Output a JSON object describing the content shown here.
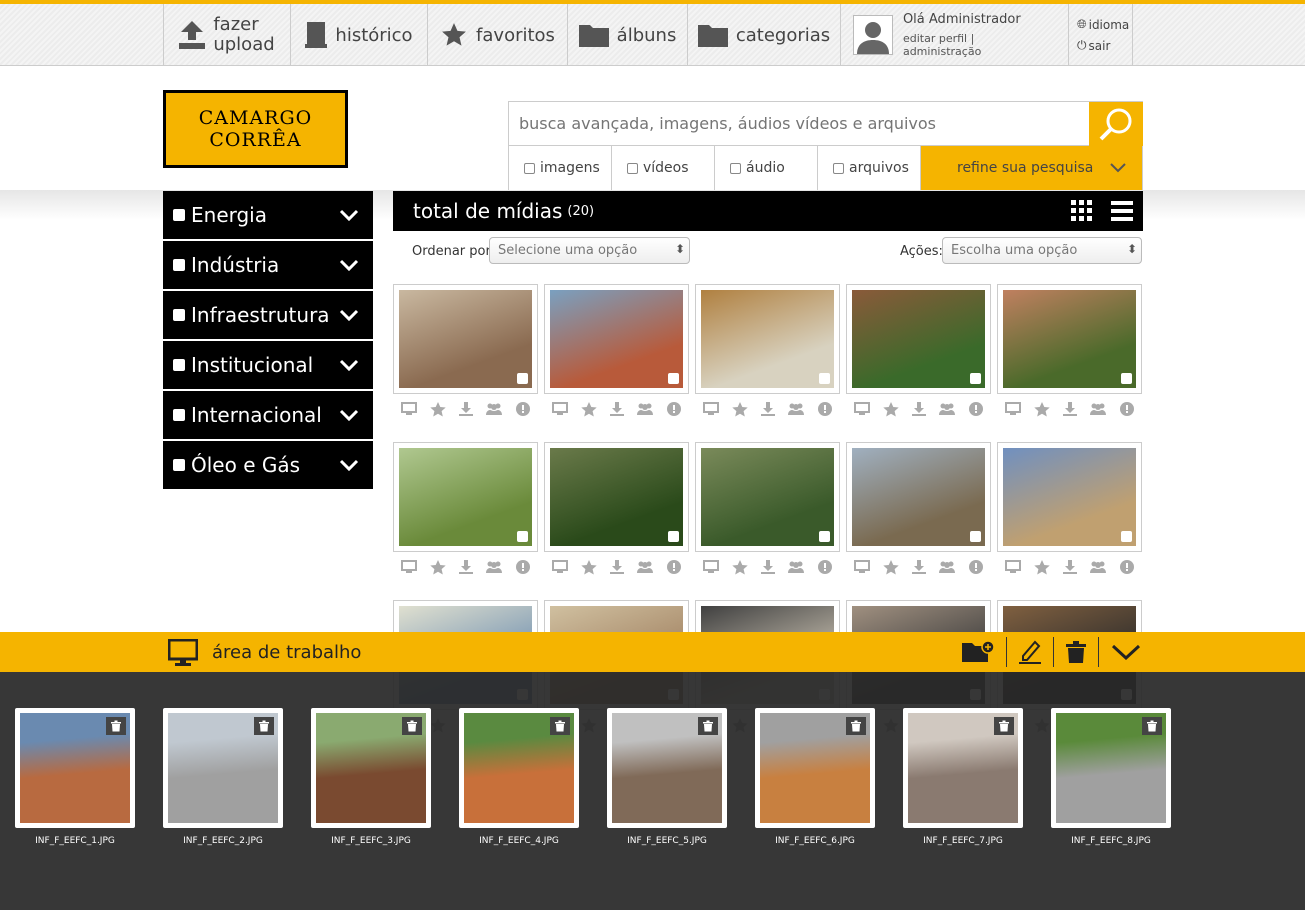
{
  "nav": {
    "upload_line1": "fazer",
    "upload_line2": "upload",
    "history": "histórico",
    "favorites": "favoritos",
    "albums": "álbuns",
    "categories": "categorias",
    "user_greeting": "Olá Administrador",
    "edit_profile": "editar perfil",
    "separator": "|",
    "admin": "administração",
    "language": "idioma",
    "logout": "sair"
  },
  "logo": {
    "line1": "CAMARGO",
    "line2": "CORRÊA"
  },
  "search": {
    "placeholder": "busca avançada, imagens, áudios vídeos e arquivos",
    "filters": [
      "imagens",
      "vídeos",
      "áudio",
      "arquivos"
    ],
    "refine": "refine sua pesquisa"
  },
  "categories": [
    "Energia",
    "Indústria",
    "Infraestrutura",
    "Institucional",
    "Internacional",
    "Óleo e Gás"
  ],
  "media": {
    "title": "total de mídias",
    "count": "(20)",
    "sort_label": "Ordenar por:",
    "sort_value": "Selecione uma opção",
    "actions_label": "Ações:",
    "actions_value": "Escolha uma opção"
  },
  "thumb_colors": [
    [
      "#8a6a50",
      "#c9b8a0"
    ],
    [
      "#b85a3a",
      "#7aa0c0"
    ],
    [
      "#d8d2c0",
      "#b08040"
    ],
    [
      "#3a6a2a",
      "#8a5a3a"
    ],
    [
      "#4a6a2a",
      "#c08060"
    ],
    [
      "#6a8a3a",
      "#b0c890"
    ],
    [
      "#2a4a1a",
      "#6a7a4a"
    ],
    [
      "#3a5a2a",
      "#7a8a5a"
    ],
    [
      "#7a6a50",
      "#a0b0c0"
    ],
    [
      "#c0a070",
      "#7090c0"
    ],
    [
      "#7090b0",
      "#e0e0d0"
    ],
    [
      "#a08060",
      "#d0c0a0"
    ],
    [
      "#c8c0b0",
      "#404040"
    ],
    [
      "#3a3a3a",
      "#a09080"
    ],
    [
      "#2a2a2a",
      "#806040"
    ]
  ],
  "workspace": {
    "title": "área de trabalho",
    "files": [
      {
        "name": "INF_F_EEFC_1.JPG",
        "colors": [
          "#b86a40",
          "#6a8ab0"
        ]
      },
      {
        "name": "INF_F_EEFC_2.JPG",
        "colors": [
          "#a0a0a0",
          "#c0c8d0"
        ]
      },
      {
        "name": "INF_F_EEFC_3.JPG",
        "colors": [
          "#7a4a30",
          "#8aaa70"
        ]
      },
      {
        "name": "INF_F_EEFC_4.JPG",
        "colors": [
          "#c8703a",
          "#5a8a40"
        ]
      },
      {
        "name": "INF_F_EEFC_5.JPG",
        "colors": [
          "#806a58",
          "#c0c0c0"
        ]
      },
      {
        "name": "INF_F_EEFC_6.JPG",
        "colors": [
          "#c88040",
          "#a0a0a0"
        ]
      },
      {
        "name": "INF_F_EEFC_7.JPG",
        "colors": [
          "#8a7a70",
          "#d0c8c0"
        ]
      },
      {
        "name": "INF_F_EEFC_8.JPG",
        "colors": [
          "#a0a0a0",
          "#5a8a3a"
        ]
      }
    ]
  },
  "accent_color": "#f5b400"
}
